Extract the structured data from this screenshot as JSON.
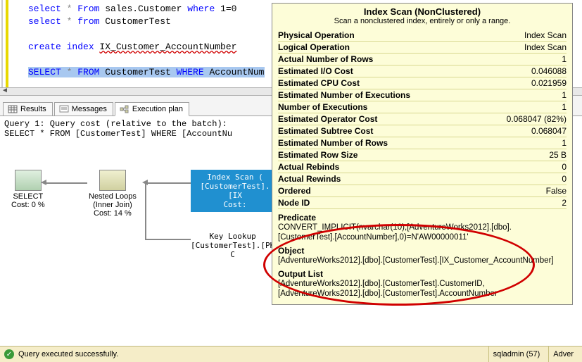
{
  "code": {
    "line1_pre": "select",
    "line1_star": " * ",
    "line1_from": "From",
    "line1_tbl": " sales.Customer ",
    "line1_where": "where",
    "line1_cond": " 1=0",
    "line2_pre": "select",
    "line2_star": " * ",
    "line2_from": "from",
    "line2_tbl": " CustomerTest",
    "line3_pre": "create",
    "line3_mid": " index ",
    "line3_name": "IX_Customer_AccountNumber",
    "line4_sel": "SELECT",
    "line4_star": " * ",
    "line4_from": "FROM",
    "line4_tbl": " CustomerTest ",
    "line4_where": "WHERE",
    "line4_col": " AccountNum"
  },
  "tabs": {
    "results": "Results",
    "messages": "Messages",
    "exec_plan": "Execution plan"
  },
  "plan": {
    "header_line1": "Query 1: Query cost (relative to the batch):",
    "header_line2": "SELECT * FROM [CustomerTest] WHERE [AccountNu",
    "select_label": "SELECT",
    "select_cost": "Cost: 0 %",
    "nested_label": "Nested Loops",
    "nested_sub": "(Inner Join)",
    "nested_cost": "Cost: 14 %",
    "scan_line1": "Index Scan (",
    "scan_line2": "[CustomerTest].[IX",
    "scan_line3": "Cost:",
    "key_lookup1": "Key Lookup",
    "key_lookup2": "[CustomerTest].[PK",
    "key_lookup3": "C"
  },
  "tooltip": {
    "title": "Index Scan (NonClustered)",
    "subtitle": "Scan a nonclustered index, entirely or only a range.",
    "rows": [
      {
        "l": "Physical Operation",
        "v": "Index Scan"
      },
      {
        "l": "Logical Operation",
        "v": "Index Scan"
      },
      {
        "l": "Actual Number of Rows",
        "v": "1"
      },
      {
        "l": "Estimated I/O Cost",
        "v": "0.046088"
      },
      {
        "l": "Estimated CPU Cost",
        "v": "0.021959"
      },
      {
        "l": "Estimated Number of Executions",
        "v": "1"
      },
      {
        "l": "Number of Executions",
        "v": "1"
      },
      {
        "l": "Estimated Operator Cost",
        "v": "0.068047 (82%)"
      },
      {
        "l": "Estimated Subtree Cost",
        "v": "0.068047"
      },
      {
        "l": "Estimated Number of Rows",
        "v": "1"
      },
      {
        "l": "Estimated Row Size",
        "v": "25 B"
      },
      {
        "l": "Actual Rebinds",
        "v": "0"
      },
      {
        "l": "Actual Rewinds",
        "v": "0"
      },
      {
        "l": "Ordered",
        "v": "False"
      },
      {
        "l": "Node ID",
        "v": "2"
      }
    ],
    "predicate_title": "Predicate",
    "predicate_body": "CONVERT_IMPLICIT(nvarchar(10),[AdventureWorks2012].[dbo].[CustomerTest].[AccountNumber],0)=N'AW00000011'",
    "object_title": "Object",
    "object_body": "[AdventureWorks2012].[dbo].[CustomerTest].[IX_Customer_AccountNumber]",
    "output_title": "Output List",
    "output_body": "[AdventureWorks2012].[dbo].[CustomerTest].CustomerID, [AdventureWorks2012].[dbo].[CustomerTest].AccountNumber"
  },
  "status": {
    "ok_text": "Query executed successfully.",
    "seg_user": "sqladmin (57)",
    "seg_db": "Adver"
  }
}
